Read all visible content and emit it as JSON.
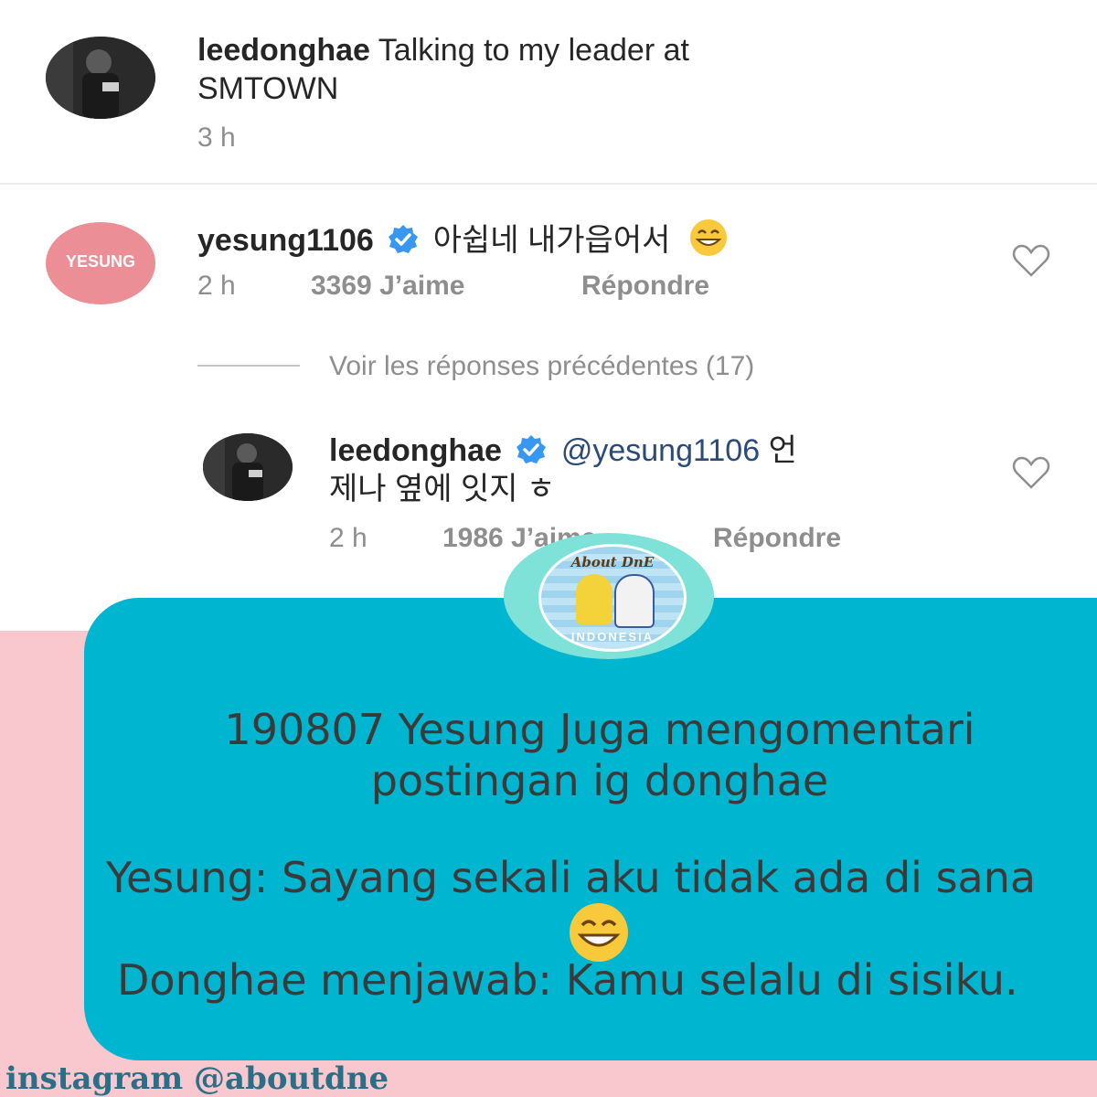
{
  "post": {
    "username": "leedonghae",
    "caption_line1": "Talking to my leader at",
    "caption_line2": "SMTOWN",
    "time": "3 h"
  },
  "comment1": {
    "avatar_text": "YESUNG",
    "username": "yesung1106",
    "text": "아쉽네 내가읍어서",
    "time": "2 h",
    "likes": "3369 J’aime",
    "reply": "Répondre"
  },
  "view_replies": "Voir les réponses précédentes (17)",
  "reply1": {
    "username": "leedonghae",
    "mention": "@yesung1106",
    "text_line1_suffix": "언",
    "text_line2": "제나 옆에 잇지 ㅎ",
    "time": "2 h",
    "likes": "1986 J’aime",
    "reply": "Répondre"
  },
  "badge": {
    "top_text": "About DnE",
    "bottom_text": "INDONESIA"
  },
  "overlay": {
    "line1": "190807 Yesung Juga mengomentari",
    "line2": "postingan ig donghae",
    "line3": "Yesung: Sayang sekali aku tidak ada di sana",
    "line4": "Donghae menjawab: Kamu selalu di sisiku."
  },
  "footer": "instagram @aboutdne",
  "colors": {
    "teal": "#00b5cf",
    "pink": "#f9c8cf",
    "verified_blue": "#3897f0"
  },
  "icons": [
    "verified-badge-icon",
    "heart-icon",
    "grin-emoji-icon"
  ]
}
